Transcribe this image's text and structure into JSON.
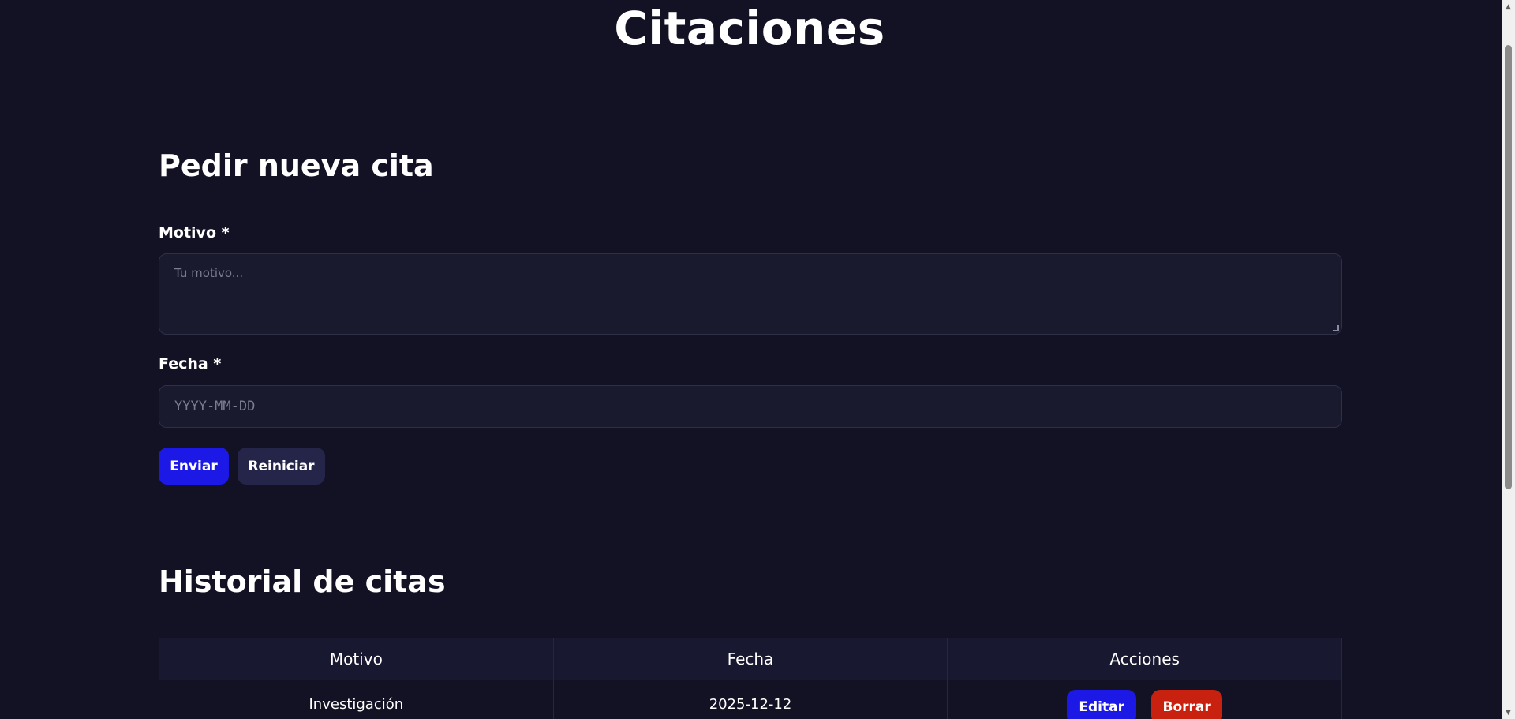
{
  "header": {
    "title": "Citaciones"
  },
  "form": {
    "heading": "Pedir nueva cita",
    "motivo_label": "Motivo *",
    "motivo_placeholder": "Tu motivo...",
    "fecha_label": "Fecha *",
    "fecha_placeholder": "YYYY-MM-DD",
    "submit_label": "Enviar",
    "reset_label": "Reiniciar"
  },
  "history": {
    "heading": "Historial de citas",
    "columns": [
      "Motivo",
      "Fecha",
      "Acciones"
    ],
    "rows": [
      {
        "motivo": "Investigación",
        "fecha": "2025-12-12",
        "edit_label": "Editar",
        "delete_label": "Borrar"
      }
    ]
  },
  "colors": {
    "background": "#121224",
    "primary": "#1c19e6",
    "danger": "#c9210f",
    "secondary": "#25254a"
  }
}
